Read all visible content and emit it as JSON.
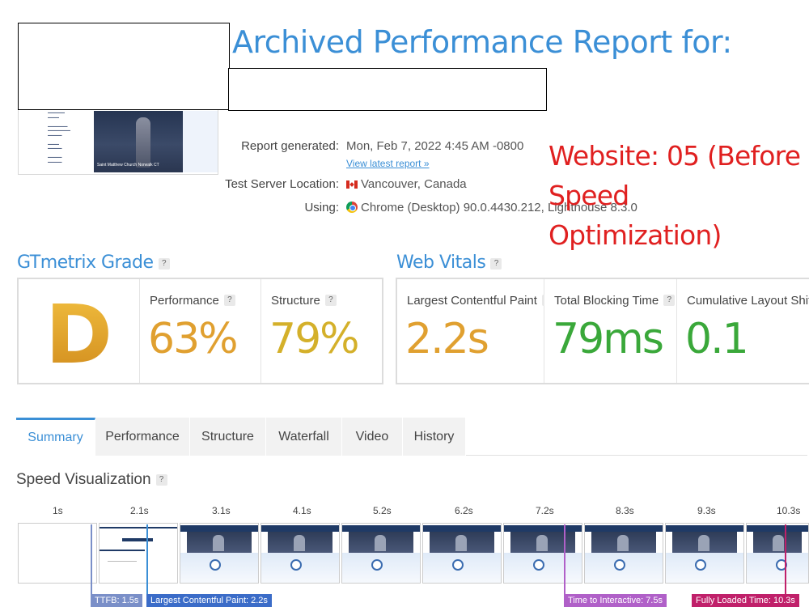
{
  "header": {
    "title": "Archived Performance Report for:"
  },
  "thumbnail": {
    "caption": "Saint Matthew Church Norwalk CT"
  },
  "meta": {
    "report_generated_label": "Report generated:",
    "report_generated_value": "Mon, Feb 7, 2022 4:45 AM -0800",
    "latest_link": "View latest report »",
    "server_label": "Test Server Location:",
    "server_value": "Vancouver, Canada",
    "using_label": "Using:",
    "using_value": "Chrome (Desktop) 90.0.4430.212, Lighthouse 8.3.0"
  },
  "annotation": {
    "line1": "Website: 05 (Before",
    "line2": "Speed Optimization)"
  },
  "grade": {
    "heading": "GTmetrix Grade",
    "letter": "D",
    "performance_label": "Performance",
    "performance_value": "63%",
    "structure_label": "Structure",
    "structure_value": "79%",
    "colors": {
      "grade": "#e0a030",
      "performance": "#e0a030",
      "structure": "#d4b02a"
    }
  },
  "vitals": {
    "heading": "Web Vitals",
    "lcp_label": "Largest Contentful Paint",
    "lcp_value": "2.2s",
    "tbt_label": "Total Blocking Time",
    "tbt_value": "79ms",
    "cls_label": "Cumulative Layout Shift",
    "cls_value": "0.1",
    "colors": {
      "lcp": "#e0a030",
      "tbt": "#3aa83a",
      "cls": "#3aa83a"
    }
  },
  "tabs": [
    "Summary",
    "Performance",
    "Structure",
    "Waterfall",
    "Video",
    "History"
  ],
  "speed": {
    "heading": "Speed Visualization",
    "ticks": [
      "1s",
      "2.1s",
      "3.1s",
      "4.1s",
      "5.2s",
      "6.2s",
      "7.2s",
      "8.3s",
      "9.3s",
      "10.3s"
    ],
    "markers": {
      "ttfb": "TTFB: 1.5s",
      "lcp": "Largest Contentful Paint: 2.2s",
      "tti": "Time to Interactive: 7.5s",
      "fully_loaded": "Fully Loaded Time: 10.3s"
    }
  },
  "help_icon": "?"
}
